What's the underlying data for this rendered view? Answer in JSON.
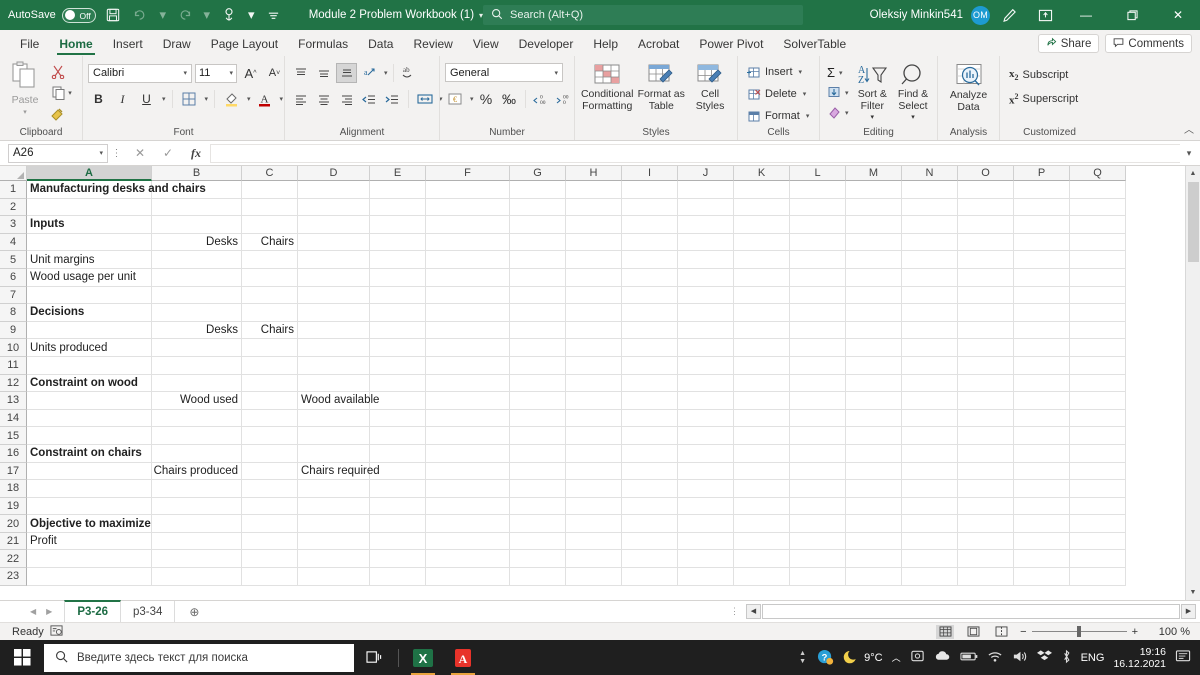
{
  "titlebar": {
    "autosave_label": "AutoSave",
    "autosave_state": "Off",
    "save_icon": "save-icon",
    "undo_icon": "undo-icon",
    "redo_icon": "redo-icon",
    "touch_icon": "touch-mode-icon",
    "customize_icon": "customize-quick-access-icon",
    "document_title": "Module 2 Problem Workbook (1)",
    "search_placeholder": "Search (Alt+Q)",
    "user_name": "Oleksiy Minkin541",
    "user_initials": "OM",
    "pen_icon": "ink-pen-icon",
    "ribbon_display_icon": "ribbon-display-options-icon",
    "minimize": "—",
    "restore": "❐",
    "close": "✕",
    "accent_color": "#217346"
  },
  "tabs": {
    "items": [
      {
        "label": "File",
        "active": false
      },
      {
        "label": "Home",
        "active": true
      },
      {
        "label": "Insert",
        "active": false
      },
      {
        "label": "Draw",
        "active": false
      },
      {
        "label": "Page Layout",
        "active": false
      },
      {
        "label": "Formulas",
        "active": false
      },
      {
        "label": "Data",
        "active": false
      },
      {
        "label": "Review",
        "active": false
      },
      {
        "label": "View",
        "active": false
      },
      {
        "label": "Developer",
        "active": false
      },
      {
        "label": "Help",
        "active": false
      },
      {
        "label": "Acrobat",
        "active": false
      },
      {
        "label": "Power Pivot",
        "active": false
      },
      {
        "label": "SolverTable",
        "active": false
      }
    ],
    "share_label": "Share",
    "comments_label": "Comments"
  },
  "ribbon": {
    "clipboard": {
      "group_label": "Clipboard",
      "paste_label": "Paste",
      "cut_label": "Cut",
      "copy_label": "Copy",
      "format_painter_label": "Format Painter"
    },
    "font": {
      "group_label": "Font",
      "font_name": "Calibri",
      "font_size": "11",
      "grow_label": "A",
      "shrink_label": "A",
      "bold_label": "B",
      "italic_label": "I",
      "underline_label": "U"
    },
    "alignment": {
      "group_label": "Alignment"
    },
    "number": {
      "group_label": "Number",
      "format": "General",
      "percent_label": "%",
      "comma_label": "‰"
    },
    "styles": {
      "group_label": "Styles",
      "conditional_formatting": "Conditional Formatting",
      "format_as_table": "Format as Table",
      "cell_styles": "Cell Styles"
    },
    "cells": {
      "group_label": "Cells",
      "insert_label": "Insert",
      "delete_label": "Delete",
      "format_label": "Format"
    },
    "editing": {
      "group_label": "Editing",
      "autosum_label": "Σ",
      "sort_filter_label": "Sort & Filter",
      "find_select_label": "Find & Select"
    },
    "analysis": {
      "group_label": "Analysis",
      "analyze_data_label": "Analyze Data"
    },
    "customized": {
      "group_label": "Customized",
      "subscript_label": "Subscript",
      "superscript_label": "Superscript"
    }
  },
  "formula_bar": {
    "name_box": "A26",
    "cancel_icon": "cancel-icon",
    "enter_icon": "enter-icon",
    "function_icon": "insert-function-icon",
    "formula_value": ""
  },
  "grid": {
    "columns": [
      "A",
      "B",
      "C",
      "D",
      "E",
      "F",
      "G",
      "H",
      "I",
      "J",
      "K",
      "L",
      "M",
      "N",
      "O",
      "P",
      "Q"
    ],
    "selected_column": "A",
    "rows": [
      {
        "n": 1,
        "cells": [
          {
            "col": "A",
            "text": "Manufacturing desks and chairs",
            "bold": true,
            "align": "left",
            "overflow": true
          }
        ]
      },
      {
        "n": 2,
        "cells": []
      },
      {
        "n": 3,
        "cells": [
          {
            "col": "A",
            "text": "Inputs",
            "bold": true,
            "align": "left"
          }
        ]
      },
      {
        "n": 4,
        "cells": [
          {
            "col": "B",
            "text": "Desks",
            "bold": false,
            "align": "right"
          },
          {
            "col": "C",
            "text": "Chairs",
            "bold": false,
            "align": "right"
          }
        ]
      },
      {
        "n": 5,
        "cells": [
          {
            "col": "A",
            "text": "Unit margins",
            "bold": false,
            "align": "left"
          }
        ]
      },
      {
        "n": 6,
        "cells": [
          {
            "col": "A",
            "text": "Wood usage per unit",
            "bold": false,
            "align": "left",
            "overflow": true
          }
        ]
      },
      {
        "n": 7,
        "cells": []
      },
      {
        "n": 8,
        "cells": [
          {
            "col": "A",
            "text": "Decisions",
            "bold": true,
            "align": "left"
          }
        ]
      },
      {
        "n": 9,
        "cells": [
          {
            "col": "B",
            "text": "Desks",
            "bold": false,
            "align": "right"
          },
          {
            "col": "C",
            "text": "Chairs",
            "bold": false,
            "align": "right"
          }
        ]
      },
      {
        "n": 10,
        "cells": [
          {
            "col": "A",
            "text": "Units produced",
            "bold": false,
            "align": "left"
          }
        ]
      },
      {
        "n": 11,
        "cells": []
      },
      {
        "n": 12,
        "cells": [
          {
            "col": "A",
            "text": "Constraint on wood",
            "bold": true,
            "align": "left",
            "overflow": true
          }
        ]
      },
      {
        "n": 13,
        "cells": [
          {
            "col": "B",
            "text": "Wood used",
            "bold": false,
            "align": "right"
          },
          {
            "col": "D",
            "text": "Wood available",
            "bold": false,
            "align": "left",
            "overflow": true
          }
        ]
      },
      {
        "n": 14,
        "cells": []
      },
      {
        "n": 15,
        "cells": []
      },
      {
        "n": 16,
        "cells": [
          {
            "col": "A",
            "text": "Constraint on chairs",
            "bold": true,
            "align": "left",
            "overflow": true
          }
        ]
      },
      {
        "n": 17,
        "cells": [
          {
            "col": "B",
            "text": "Chairs produced",
            "bold": false,
            "align": "right",
            "overflow": true
          },
          {
            "col": "D",
            "text": "Chairs required",
            "bold": false,
            "align": "left",
            "overflow": true
          }
        ]
      },
      {
        "n": 18,
        "cells": []
      },
      {
        "n": 19,
        "cells": []
      },
      {
        "n": 20,
        "cells": [
          {
            "col": "A",
            "text": "Objective to maximize",
            "bold": true,
            "align": "left",
            "overflow": true
          }
        ]
      },
      {
        "n": 21,
        "cells": [
          {
            "col": "A",
            "text": "Profit",
            "bold": false,
            "align": "left"
          }
        ]
      },
      {
        "n": 22,
        "cells": []
      },
      {
        "n": 23,
        "cells": []
      }
    ]
  },
  "sheets": {
    "items": [
      {
        "label": "P3-26",
        "active": true
      },
      {
        "label": "p3-34",
        "active": false
      }
    ],
    "add_label": "⊕",
    "prev_label": "◀",
    "next_label": "▶"
  },
  "statusbar": {
    "status": "Ready",
    "accessibility_icon": "accessibility-checker-icon",
    "normal_view_icon": "normal-view-icon",
    "page_layout_icon": "page-layout-view-icon",
    "page_break_icon": "page-break-preview-icon",
    "zoom_out": "−",
    "zoom_in": "+",
    "zoom_level": "100 %"
  },
  "taskbar": {
    "start_icon": "windows-start-icon",
    "search_placeholder": "Введите здесь текст для поиска",
    "task_view_icon": "task-view-icon",
    "apps": [
      {
        "name": "excel-taskbar-icon",
        "glyph": "X"
      },
      {
        "name": "acrobat-taskbar-icon",
        "glyph": "⬟"
      }
    ],
    "tray": {
      "help_icon": "help-circle-icon",
      "weather_icon": "moon-weather-icon",
      "weather_temp": "9°C",
      "show_hidden_icon": "show-hidden-icons-icon",
      "onedrive_icon": "onedrive-icon",
      "cloud_icon": "cloud-icon",
      "battery_icon": "battery-icon",
      "wifi_icon": "wifi-icon",
      "volume_icon": "volume-icon",
      "dropbox_icon": "dropbox-icon",
      "bluetooth_icon": "bluetooth-icon",
      "language": "ENG",
      "time": "19:16",
      "date": "16.12.2021",
      "notifications_icon": "notifications-icon"
    }
  }
}
